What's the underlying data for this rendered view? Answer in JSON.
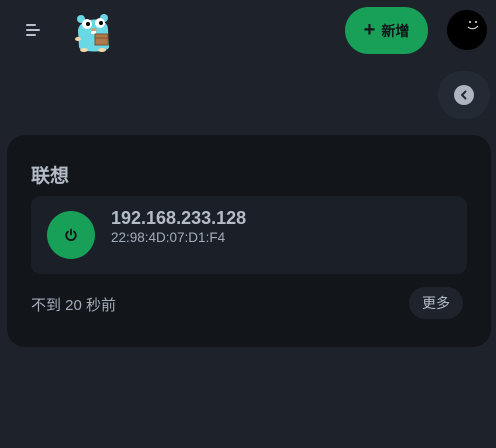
{
  "header": {
    "menu_icon": "hamburger-menu-icon",
    "logo_icon": "gopher-logo-icon",
    "add_button": {
      "icon": "plus-icon",
      "label": "新增"
    },
    "avatar_icon": "user-avatar-icon"
  },
  "back_button": {
    "icon": "chevron-left-icon"
  },
  "card": {
    "title": "联想",
    "device": {
      "power_icon": "power-icon",
      "ip": "192.168.233.128",
      "mac": "22:98:4D:07:D1:F4"
    },
    "last_seen": "不到 20 秒前",
    "more_label": "更多"
  },
  "colors": {
    "background": "#1e232b",
    "card": "#121519",
    "accent": "#18a058"
  }
}
